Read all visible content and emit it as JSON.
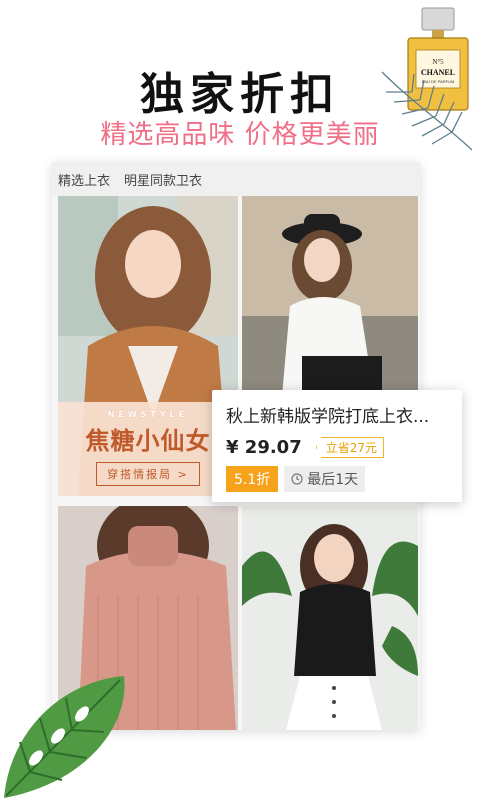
{
  "headline": "独家折扣",
  "subline": "精选高品味 价格更美丽",
  "panel": {
    "tabs": [
      "精选上衣",
      "明星同款卫衣"
    ]
  },
  "promo": {
    "small": "NEWSTYLE",
    "big": "焦糖小仙女",
    "button": "穿搭情报局 >"
  },
  "perfume": {
    "number": "N°5",
    "brand": "CHANEL",
    "sub": "EAU DE PARFUM"
  },
  "card": {
    "title": "秋上新韩版学院打底上衣...",
    "price": "¥ 29.07",
    "save": "立省27元",
    "discount": "5.1折",
    "timer": "最后1天"
  },
  "colors": {
    "accent": "#ef6f86",
    "discount": "#f7a21b",
    "save": "#e8a200",
    "promo_text": "#c05a2a"
  },
  "icons": {
    "timer": "clock-icon"
  }
}
